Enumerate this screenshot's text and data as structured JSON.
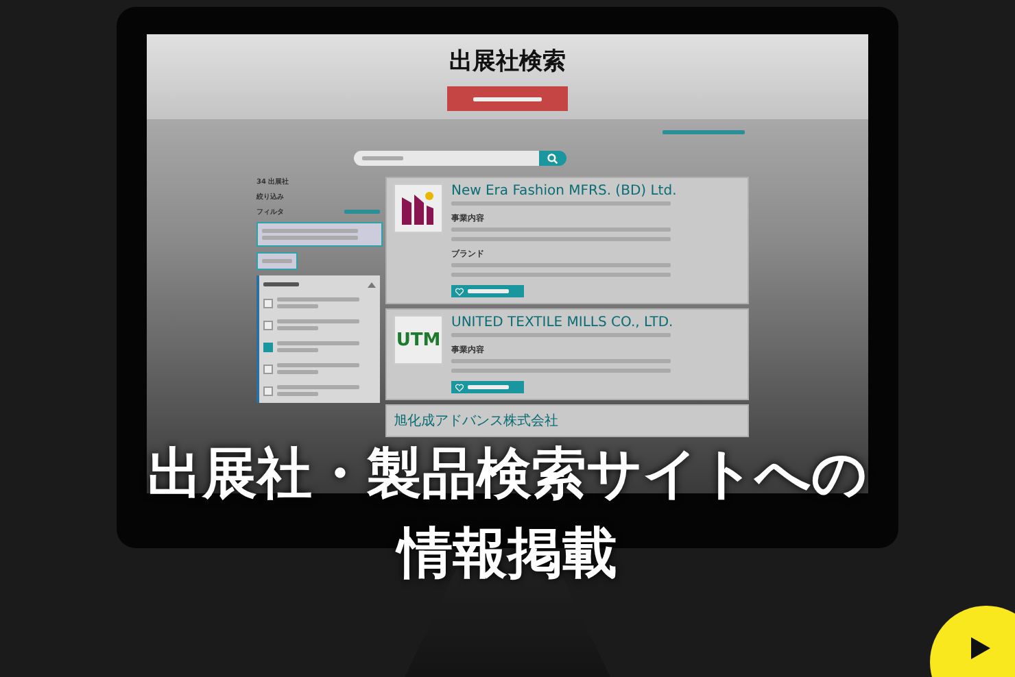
{
  "screen": {
    "page_title": "出展社検索",
    "sidebar": {
      "count": "34 出展社",
      "heading": "絞り込み",
      "filter_label": "フィルタ",
      "options": [
        {
          "checked": false
        },
        {
          "checked": false
        },
        {
          "checked": true
        },
        {
          "checked": false
        },
        {
          "checked": false
        }
      ]
    },
    "results": [
      {
        "name": "New Era Fashion MFRS. (BD) Ltd.",
        "logo": {
          "kind": "emblem"
        },
        "sections": [
          "事業内容",
          "ブランド"
        ]
      },
      {
        "name": "UNITED TEXTILE MILLS CO., LTD.",
        "logo": {
          "kind": "monogram",
          "text": "UTM"
        },
        "sections": [
          "事業内容"
        ]
      },
      {
        "name": "旭化成アドバンス株式会社"
      }
    ]
  },
  "banner": {
    "headline_lines": [
      "出展社・製品検索サイトへの",
      "情報掲載"
    ]
  }
}
